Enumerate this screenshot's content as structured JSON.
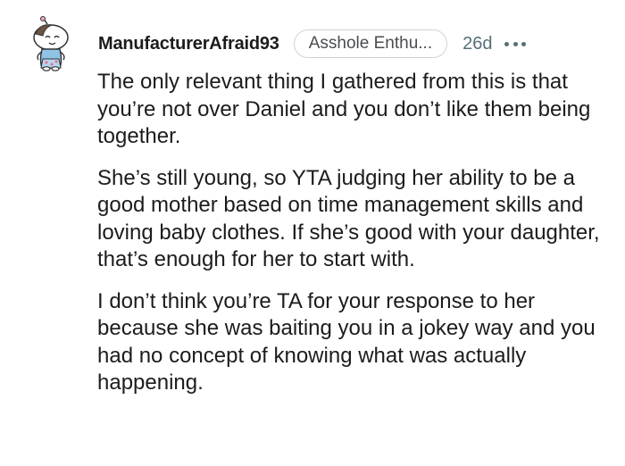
{
  "comment": {
    "username": "ManufacturerAfraid93",
    "flair": "Asshole Enthu...",
    "timestamp": "26d",
    "avatar_icon": "snoo-avatar-icon",
    "more_icon": "more-options-icon",
    "paragraphs": [
      "The only relevant thing I gathered from this is that you’re not over Daniel and you don’t like them being together.",
      "She’s still young, so YTA judging her ability to be a good mother based on time management skills and loving baby clothes. If she’s good with your daughter, that’s enough for her to start with.",
      "I don’t think you’re TA for your response to her because she was baiting you in a jokey way and you had no concept of knowing what was actually happening."
    ]
  },
  "colors": {
    "text": "#1c1c1c",
    "meta": "#576f76",
    "flair_border": "#cfd3d6",
    "background": "#ffffff"
  }
}
